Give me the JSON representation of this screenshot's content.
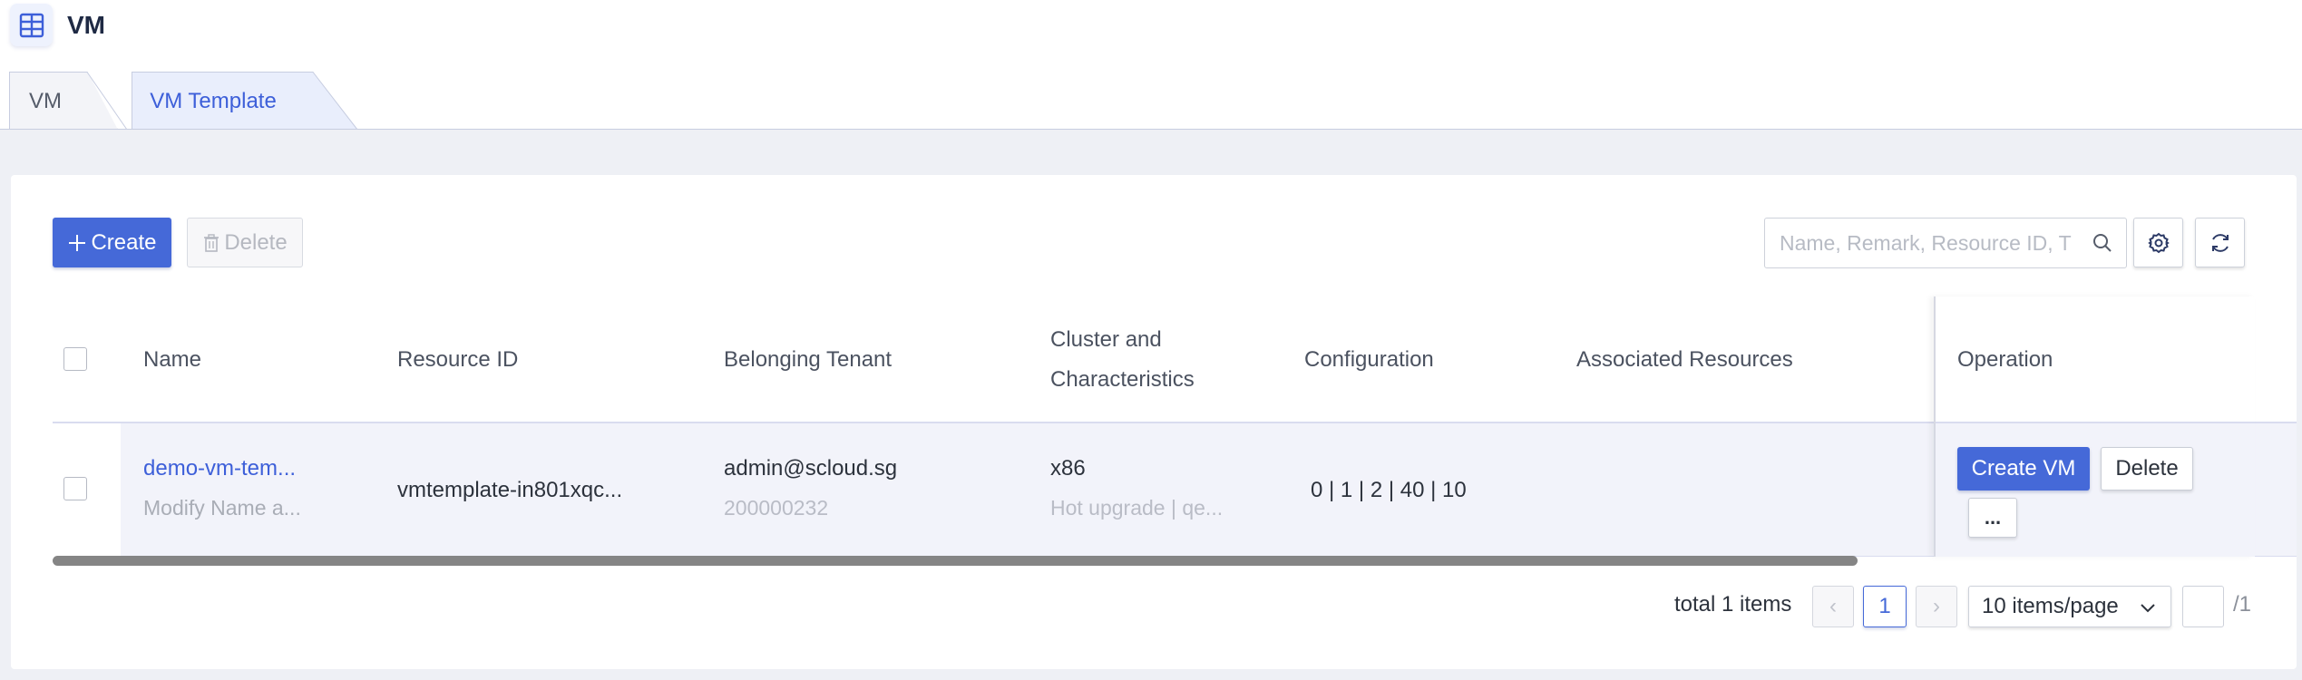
{
  "app": {
    "title": "VM"
  },
  "tabs": [
    {
      "label": "VM",
      "active": false
    },
    {
      "label": "VM Template",
      "active": true
    }
  ],
  "toolbar": {
    "create_label": "Create",
    "delete_label": "Delete",
    "search_placeholder": "Name, Remark, Resource ID, T"
  },
  "table": {
    "headers": {
      "name": "Name",
      "resource_id": "Resource ID",
      "tenant": "Belonging Tenant",
      "cluster_line1": "Cluster and",
      "cluster_line2": "Characteristics",
      "configuration": "Configuration",
      "associated": "Associated Resources",
      "operation": "Operation"
    },
    "rows": [
      {
        "name": "demo-vm-tem...",
        "remark": "Modify Name a...",
        "resource_id": "vmtemplate-in801xqc...",
        "tenant": "admin@scloud.sg",
        "tenant_id": "200000232",
        "cluster": "x86",
        "characteristics": "Hot upgrade | qe...",
        "configuration": "0 | 1 | 2 | 40 | 10",
        "associated": "",
        "op_create": "Create VM",
        "op_delete": "Delete",
        "op_more": "..."
      }
    ]
  },
  "pagination": {
    "total_text": "total 1 items",
    "prev": "‹",
    "next": "›",
    "current": "1",
    "page_size": "10 items/page",
    "total_pages": "/1"
  },
  "colors": {
    "accent": "#4569d8",
    "link": "#3d5fd9"
  }
}
